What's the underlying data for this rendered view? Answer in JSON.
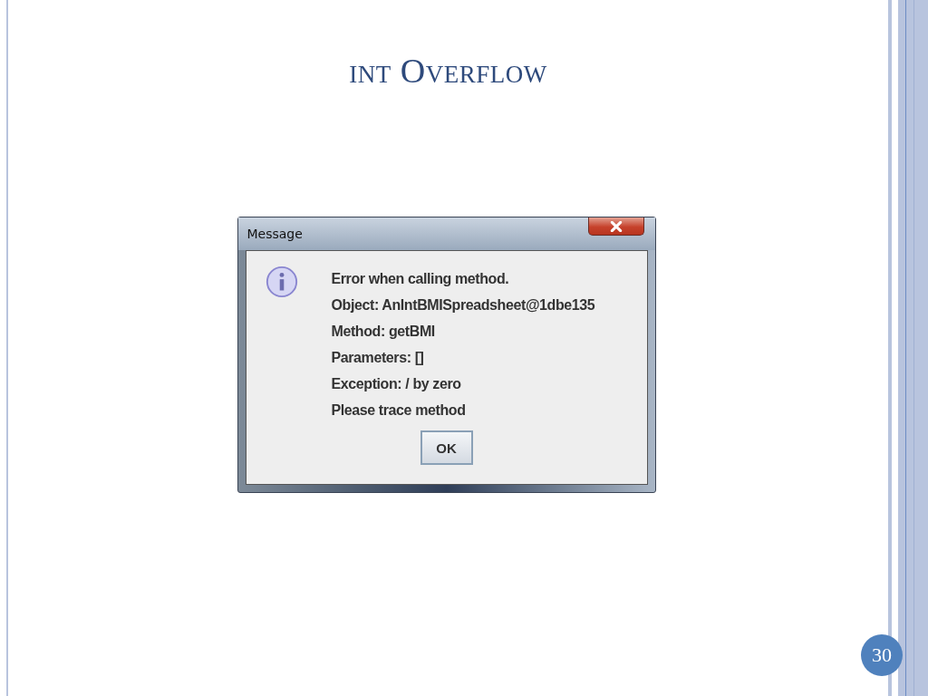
{
  "slide": {
    "title": "int Overflow",
    "page_number": "30"
  },
  "dialog": {
    "title": "Message",
    "lines": [
      "Error when calling method.",
      "Object: AnIntBMISpreadsheet@1dbe135",
      "Method: getBMI",
      "Parameters: []",
      "Exception: / by zero",
      "Please trace method"
    ],
    "buttons": [
      "OK"
    ]
  }
}
